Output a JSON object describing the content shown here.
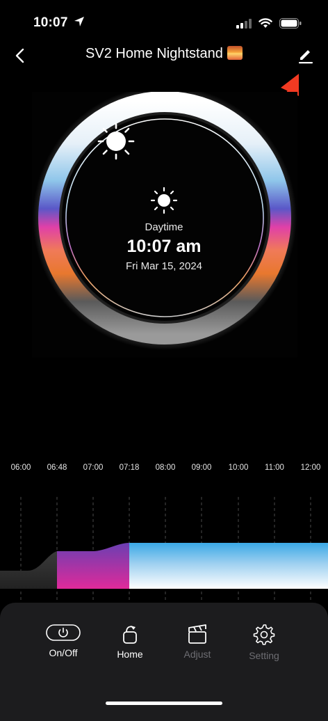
{
  "status_bar": {
    "time": "10:07"
  },
  "header": {
    "title": "SV2 Home Nightstand"
  },
  "dial": {
    "period": "Daytime",
    "time": "10:07 am",
    "date": "Fri Mar 15, 2024"
  },
  "timeline": {
    "ticks": [
      "06:00",
      "06:48",
      "07:00",
      "07:18",
      "08:00",
      "09:00",
      "10:00",
      "11:00",
      "12:00"
    ]
  },
  "bottom_nav": {
    "onoff": "On/Off",
    "home": "Home",
    "adjust": "Adjust",
    "setting": "Setting"
  },
  "colors": {
    "background": "#000000",
    "bar": "#1c1c1e",
    "inactive_label": "#6e6e73"
  }
}
